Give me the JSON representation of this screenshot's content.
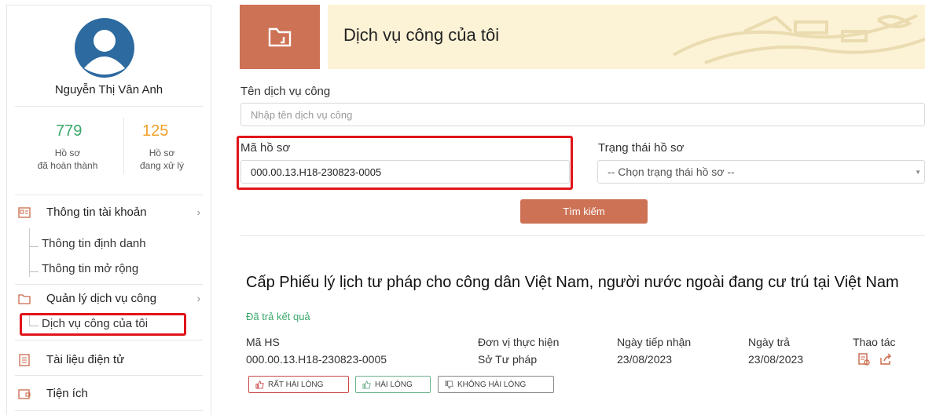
{
  "profile": {
    "name": "Nguyễn Thị Vân Anh",
    "completed_count": "779",
    "completed_label_1": "Hồ sơ",
    "completed_label_2": "đã hoàn thành",
    "processing_count": "125",
    "processing_label_1": "Hồ sơ",
    "processing_label_2": "đang xử lý"
  },
  "sidebar": {
    "account_info": "Thông tin tài khoản",
    "identity_info": "Thông tin định danh",
    "extended_info": "Thông tin mở rộng",
    "service_mgmt": "Quản lý dịch vụ công",
    "my_services": "Dịch vụ công của tôi",
    "e_documents": "Tài liệu điện tử",
    "utilities": "Tiện ích",
    "chevron": "›"
  },
  "banner": {
    "title": "Dịch vụ công của tôi"
  },
  "search": {
    "service_name_label": "Tên dịch vụ công",
    "service_name_placeholder": "Nhập tên dịch vụ công",
    "record_code_label": "Mã hồ sơ",
    "record_code_value": "000.00.13.H18-230823-0005",
    "status_label": "Trạng thái hồ sơ",
    "status_value": "-- Chọn trạng thái hồ sơ --",
    "search_button": "Tìm kiếm"
  },
  "result": {
    "title": "Cấp Phiếu lý lịch tư pháp cho công dân Việt Nam, người nước ngoài đang cư trú tại Việt Nam",
    "status": "Đã trả kết quả",
    "headers": {
      "code": "Mã HS",
      "unit": "Đơn vị thực hiện",
      "received": "Ngày tiếp nhận",
      "returned": "Ngày trả",
      "actions": "Thao tác"
    },
    "values": {
      "code": "000.00.13.H18-230823-0005",
      "unit": "Sở Tư pháp",
      "received": "23/08/2023",
      "returned": "23/08/2023"
    },
    "ratings": {
      "very_satisfied": "RẤT HÀI LÒNG",
      "satisfied": "HÀI LÒNG",
      "not_satisfied": "KHÔNG HÀI LÒNG"
    }
  },
  "colors": {
    "accent": "#cd7255",
    "banner_bg": "#fcf2d5",
    "avatar": "#2c6aa0",
    "green": "#3aa86b",
    "orange": "#f0a028",
    "highlight": "#e0141a"
  }
}
